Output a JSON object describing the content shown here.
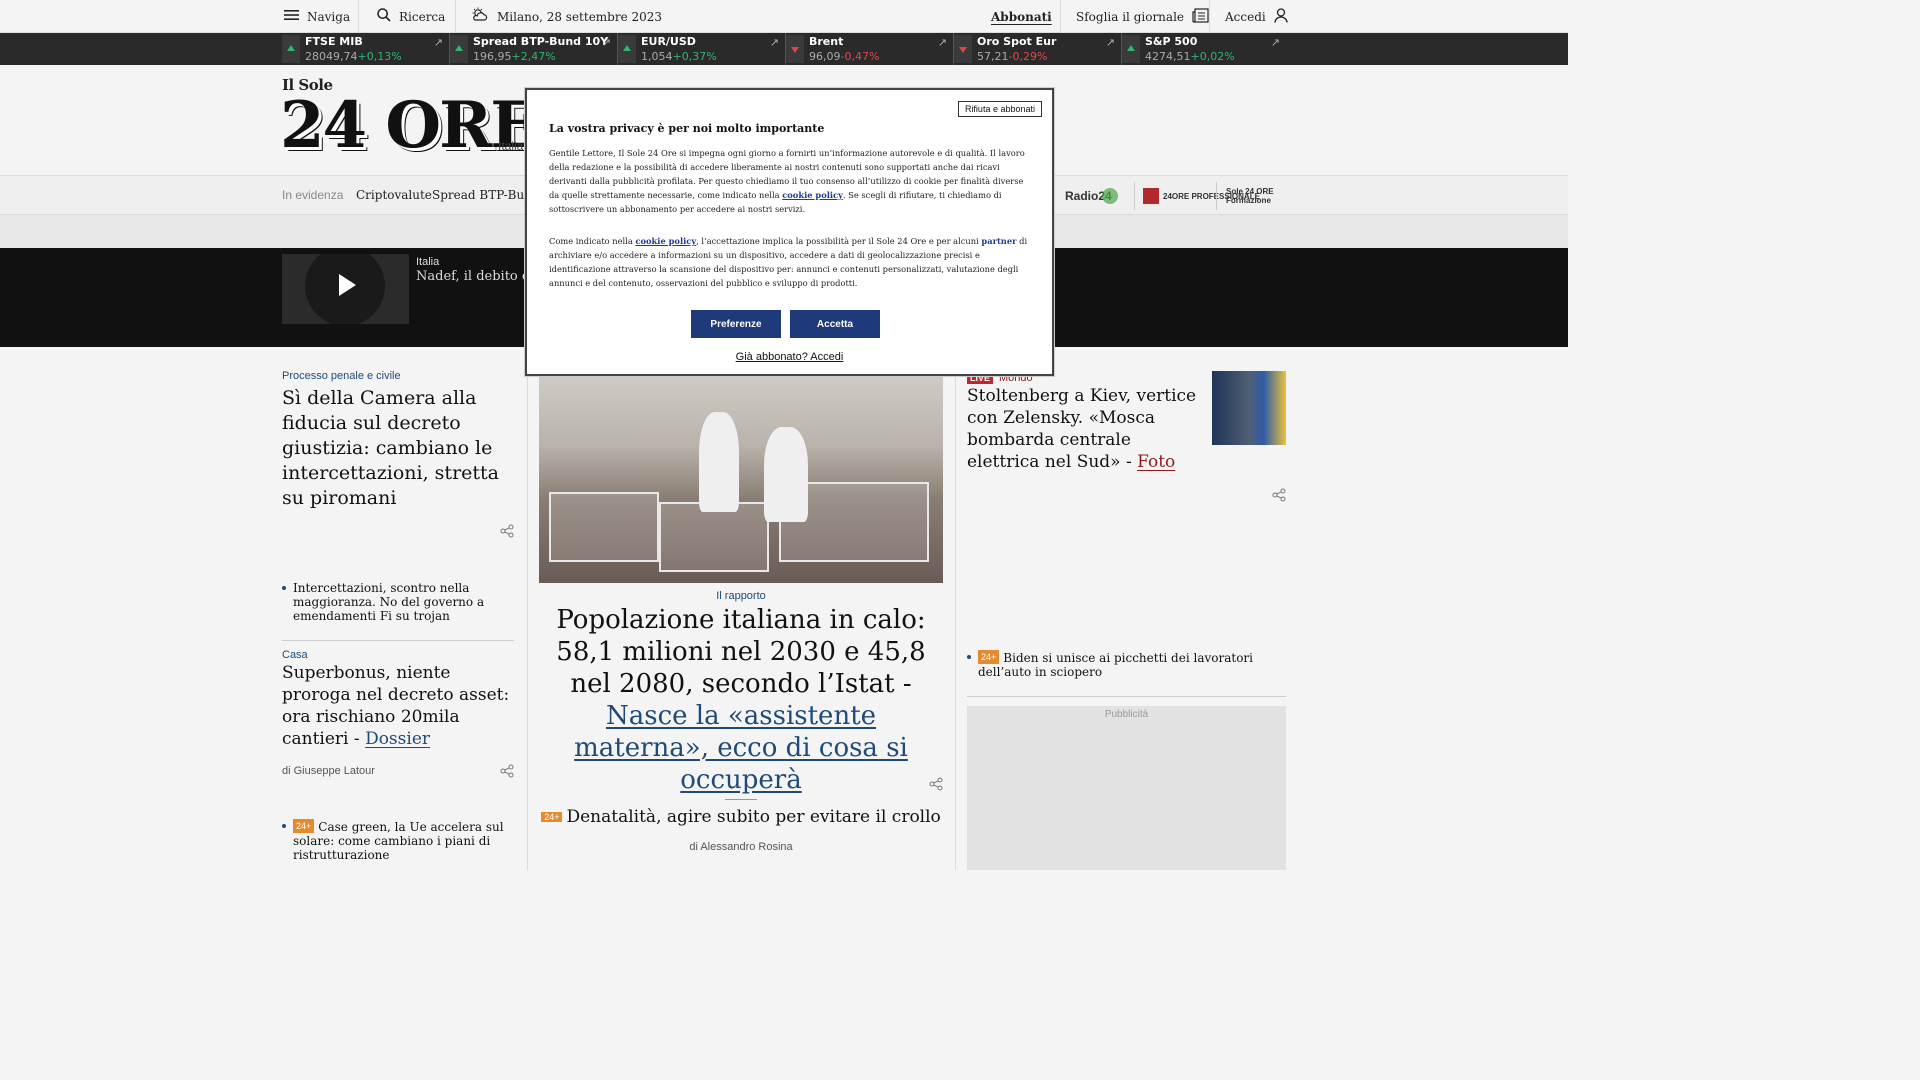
{
  "topbar": {
    "menu_label": "Naviga",
    "search_label": "Ricerca",
    "weather_text": "Milano, 28 settembre 2023",
    "subscribe_label": "Abbonati",
    "newspaper_label": "Sfoglia il giornale",
    "login_label": "Accedi"
  },
  "ticker": [
    {
      "name": "FTSE MIB",
      "value": "28049,74",
      "change": "+0,13%",
      "direction": "up"
    },
    {
      "name": "Spread BTP-Bund 10Y",
      "value": "196,95",
      "change": "+2,47%",
      "direction": "up"
    },
    {
      "name": "EUR/USD",
      "value": "1,054",
      "change": "+0,37%",
      "direction": "up"
    },
    {
      "name": "Brent",
      "value": "96,09",
      "change": "-0,47%",
      "direction": "down"
    },
    {
      "name": "Oro Spot Eur",
      "value": "57,21",
      "change": "-0,29%",
      "direction": "down"
    },
    {
      "name": "S&P 500",
      "value": "4274,51",
      "change": "+0,02%",
      "direction": "up"
    }
  ],
  "masthead": {
    "logo_small": "Il Sole",
    "logo_big": "24 ORE",
    "section": "Italia"
  },
  "evidenza": {
    "label": "In evidenza",
    "links": [
      "Criptovalute",
      "Spread BTP-Bund"
    ],
    "brands": [
      "Radio24",
      "24ORE PROFESSIONALE",
      "Sole 24 ORE Formazione"
    ]
  },
  "video": {
    "category": "Italia",
    "title": "Nadef, il debito che"
  },
  "left_col": {
    "kicker1": "Processo penale e civile",
    "headline1": "Sì della Camera alla fiducia sul decreto giustizia: cambiano le intercettazioni, stretta su piromani",
    "bullet1": "Intercettazioni, scontro nella maggioranza. No del governo a emendamenti Fi su trojan",
    "kicker2": "Casa",
    "headline2_main": "Superbonus, niente proroga nel decreto asset: ora rischiano 20mila cantieri - ",
    "headline2_link": "Dossier",
    "byline2": "di Giuseppe Latour",
    "tag": "24+",
    "bullet2": "Case green, la Ue accelera sul solare: come cambiano i piani di ristrutturazione"
  },
  "center_col": {
    "kicker": "Il rapporto",
    "headline_main": "Popolazione italiana in calo: 58,1 milioni nel 2030 e 45,8 nel 2080, secondo l’Istat - ",
    "headline_link": "Nasce la «assistente materna», ecco di cosa si occuperà",
    "tag": "24+",
    "related": "Denatalità, agire subito per evitare il crollo",
    "byline": "di Alessandro Rosina"
  },
  "right_col": {
    "live_label": "LIVE",
    "kicker": "Mondo",
    "headline_main": "Stoltenberg a Kiev, vertice con Zelensky. «Mosca bombarda centrale elettrica nel Sud» - ",
    "headline_link": "Foto",
    "tag": "24+",
    "bullet": "Biden si unisce ai picchetti dei lavoratori dell’auto in sciopero",
    "ad_label": "Pubblicità"
  },
  "modal": {
    "reject_label": "Rifiuta e abbonati",
    "title": "La vostra privacy è per noi molto importante",
    "p1_a": "Gentile Lettore, Il Sole 24 Ore si impegna ogni giorno a fornirti un’informazione autorevole e di qualità. Il lavoro della redazione e la possibilità di accedere liberamente ai nostri contenuti sono supportati anche dai ricavi derivanti dalla pubblicità profilata. Per questo chiediamo il tuo consenso all’utilizzo di cookie per finalità diverse da quelle strettamente necessarie, come indicato nella ",
    "cookie_link": "cookie policy",
    "p1_b": ". Se scegli di rifiutare, ti chiediamo di sottoscrivere un abbonamento per accedere ai nostri servizi.",
    "p2_a": "Come indicato nella ",
    "p2_b": ", l’accettazione implica la possibilità per il Sole 24 Ore e per alcuni ",
    "partner_link": "partner",
    "p2_c": " di archiviare e/o accedere a informazioni su un dispositivo, accedere a dati di geolocalizzazione precisi e identificazione attraverso la scansione del dispositivo per: annunci e contenuti personalizzati, valutazione degli annunci e del contenuto, osservazioni del pubblico e sviluppo di prodotti.",
    "prefs_label": "Preferenze",
    "accept_label": "Accetta",
    "already_label": "Già abbonato? Accedi"
  },
  "colors": {
    "accent_blue": "#1f4a7a",
    "button_blue": "#1f3a7a",
    "up_green": "#2bb673",
    "down_red": "#e0474c",
    "live_red": "#c0262d"
  }
}
